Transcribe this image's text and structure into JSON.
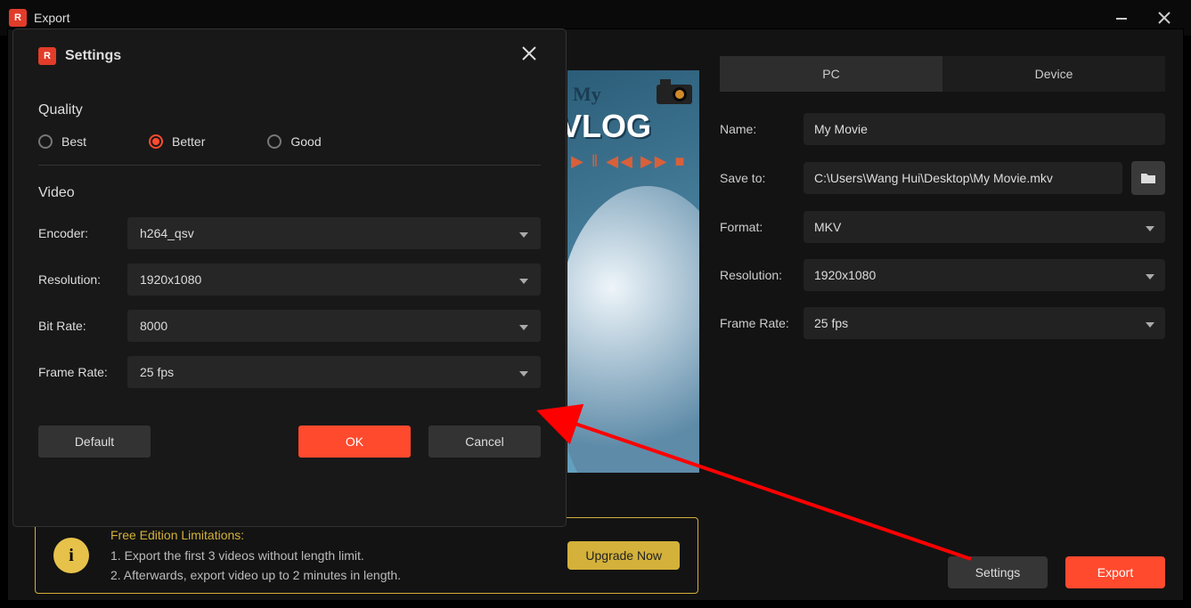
{
  "title": "Export",
  "preview": {
    "label_my": "My",
    "label_vlog": "VLOG"
  },
  "tabs": {
    "pc": "PC",
    "device": "Device"
  },
  "fields": {
    "name_label": "Name:",
    "name_value": "My Movie",
    "saveto_label": "Save to:",
    "saveto_value": "C:\\Users\\Wang Hui\\Desktop\\My Movie.mkv",
    "format_label": "Format:",
    "format_value": "MKV",
    "res_label": "Resolution:",
    "res_value": "1920x1080",
    "fps_label": "Frame Rate:",
    "fps_value": "25 fps"
  },
  "limits": {
    "title": "Free Edition Limitations:",
    "line1": "1. Export the first 3 videos without length limit.",
    "line2": "2. Afterwards, export video up to 2 minutes in length.",
    "upgrade": "Upgrade Now"
  },
  "buttons": {
    "settings": "Settings",
    "export": "Export"
  },
  "modal": {
    "title": "Settings",
    "quality_h": "Quality",
    "q_best": "Best",
    "q_better": "Better",
    "q_good": "Good",
    "video_h": "Video",
    "encoder_l": "Encoder:",
    "encoder_v": "h264_qsv",
    "res_l": "Resolution:",
    "res_v": "1920x1080",
    "br_l": "Bit Rate:",
    "br_v": "8000",
    "fr_l": "Frame Rate:",
    "fr_v": "25 fps",
    "default": "Default",
    "ok": "OK",
    "cancel": "Cancel"
  }
}
